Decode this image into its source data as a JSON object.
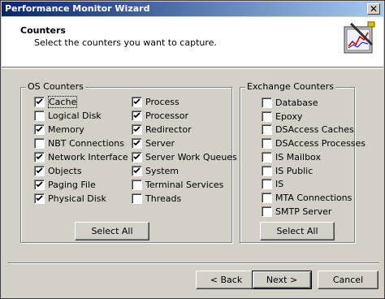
{
  "window": {
    "title": "Performance Monitor Wizard",
    "close_glyph": "✕"
  },
  "header": {
    "title": "Counters",
    "subtitle": "Select the counters you want to capture.",
    "icon": "wizard-chart-icon"
  },
  "os_counters": {
    "label": "OS Counters",
    "left": [
      {
        "label": "Cache",
        "checked": true,
        "focused": true
      },
      {
        "label": "Logical Disk",
        "checked": false
      },
      {
        "label": "Memory",
        "checked": true
      },
      {
        "label": "NBT Connections",
        "checked": false
      },
      {
        "label": "Network Interface",
        "checked": true
      },
      {
        "label": "Objects",
        "checked": true
      },
      {
        "label": "Paging File",
        "checked": true
      },
      {
        "label": "Physical Disk",
        "checked": true
      }
    ],
    "right": [
      {
        "label": "Process",
        "checked": true
      },
      {
        "label": "Processor",
        "checked": true
      },
      {
        "label": "Redirector",
        "checked": true
      },
      {
        "label": "Server",
        "checked": true
      },
      {
        "label": "Server Work Queues",
        "checked": true
      },
      {
        "label": "System",
        "checked": true
      },
      {
        "label": "Terminal Services",
        "checked": false
      },
      {
        "label": "Threads",
        "checked": false
      }
    ],
    "select_all": "Select All"
  },
  "exchange_counters": {
    "label": "Exchange Counters",
    "items": [
      {
        "label": "Database",
        "checked": false
      },
      {
        "label": "Epoxy",
        "checked": false
      },
      {
        "label": "DSAccess Caches",
        "checked": false
      },
      {
        "label": "DSAccess Processes",
        "checked": false
      },
      {
        "label": "IS Mailbox",
        "checked": false
      },
      {
        "label": "IS Public",
        "checked": false
      },
      {
        "label": "IS",
        "checked": false
      },
      {
        "label": "MTA Connections",
        "checked": false
      },
      {
        "label": "SMTP Server",
        "checked": false
      }
    ],
    "select_all": "Select All"
  },
  "footer": {
    "back": "< Back",
    "next": "Next >",
    "cancel": "Cancel"
  }
}
